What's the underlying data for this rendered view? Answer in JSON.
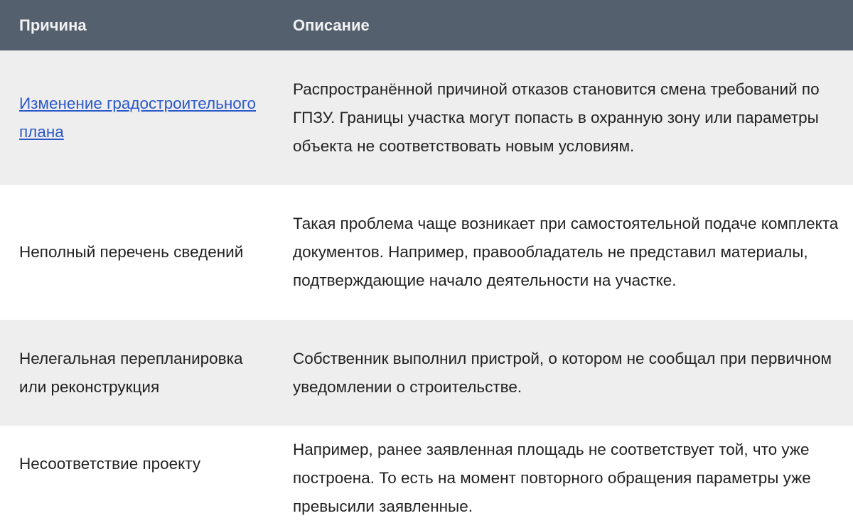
{
  "table": {
    "headers": {
      "reason": "Причина",
      "description": "Описание"
    },
    "rows": [
      {
        "reason": "Изменение градостроительного плана",
        "reason_is_link": true,
        "description": "Распространённой причиной отказов становится смена требований по ГПЗУ. Границы участка могут попасть в охранную зону или параметры объекта не соответствовать новым условиям."
      },
      {
        "reason": "Неполный перечень сведений",
        "reason_is_link": false,
        "description": "Такая проблема чаще возникает при самостоятельной подаче комплекта документов. Например, правообладатель не представил материалы, подтверждающие начало деятельности на участке."
      },
      {
        "reason": "Нелегальная перепланировка или реконструкция",
        "reason_is_link": false,
        "description": "Собственник выполнил пристрой, о котором не сообщал при первичном уведомлении о строительстве."
      },
      {
        "reason": "Несоответствие проекту",
        "reason_is_link": false,
        "description": "Например, ранее заявленная площадь не соответствует той, что уже построена. То есть на момент повторного обращения параметры уже превысили заявленные."
      }
    ]
  },
  "colors": {
    "header_bg": "#54606e",
    "header_text": "#f2f2f2",
    "row_shade": "#eeeeee",
    "link": "#2b58c9"
  }
}
